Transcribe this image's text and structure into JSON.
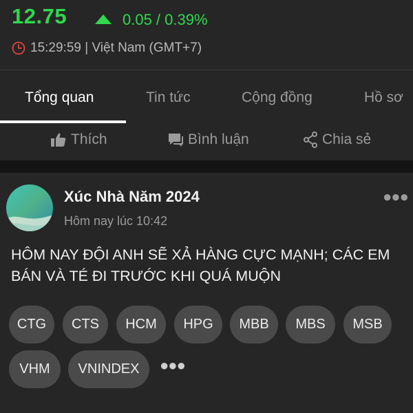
{
  "stock": {
    "price": "12.75",
    "change": "0.05 / 0.39%",
    "time": "15:29:59 | Việt Nam (GMT+7)",
    "up_color": "#2fd84e"
  },
  "tabs": [
    {
      "label": "Tổng quan",
      "active": true
    },
    {
      "label": "Tin tức",
      "active": false
    },
    {
      "label": "Cộng đồng",
      "active": false
    },
    {
      "label": "Hồ sơ",
      "active": false
    }
  ],
  "actions": {
    "like": "Thích",
    "comment": "Bình luận",
    "share": "Chia sẻ"
  },
  "post": {
    "author": "Xúc Nhà Năm 2024",
    "time": "Hôm nay lúc 10:42",
    "content": "HÔM NAY ĐỘI ANH SẼ XẢ HÀNG CỰC MẠNH; CÁC EM BÁN VÀ TÉ ĐI TRƯỚC KHI QUÁ MUỘN",
    "tags": [
      "CTG",
      "CTS",
      "HCM",
      "HPG",
      "MBB",
      "MBS",
      "MSB",
      "VHM",
      "VNINDEX"
    ],
    "more_icon": "ellipsis-icon"
  }
}
